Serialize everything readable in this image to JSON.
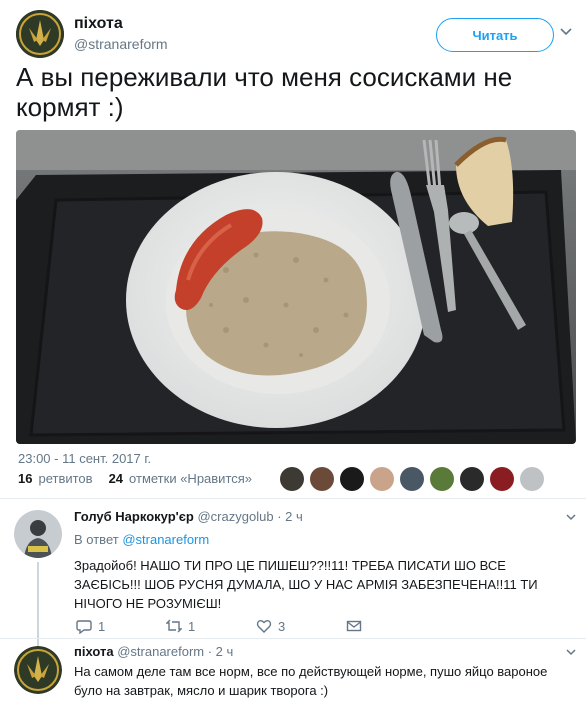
{
  "tweet": {
    "author_name": "піхота",
    "author_handle": "@stranareform",
    "follow_label": "Читать",
    "text": "А вы переживали что меня сосисками не кормят :)",
    "timestamp": "23:00 - 11 сент. 2017 г.",
    "retweets_count": "16",
    "retweets_label": "ретвитов",
    "likes_count": "24",
    "likes_label": "отметки «Нравится»"
  },
  "replies": [
    {
      "author_name": "Голуб Наркокур'єр",
      "author_handle": "@crazygolub",
      "time": "· 2 ч",
      "in_reply_prefix": "В ответ",
      "in_reply_handle": "@stranareform",
      "text": "Зрадойоб! НАШО ТИ ПРО ЦЕ ПИШЕШ??!!11! ТРЕБА ПИСАТИ ШО ВСЕ ЗАЄБІСЬ!!! ШОБ РУСНЯ ДУМАЛА, ШО У НАС АРМІЯ ЗАБЕЗПЕЧЕНА!!11 ТИ НІЧОГО НЕ РОЗУМІЄШ!",
      "reply_count": "1",
      "retweet_count": "1",
      "like_count": "3"
    },
    {
      "author_name": "піхота",
      "author_handle": "@stranareform",
      "time": "· 2 ч",
      "text": "На самом деле там все норм, все по действующей норме, пушо яйцо вароное було на завтрак, мясло и шарик творога :)"
    }
  ],
  "colors": {
    "accent": "#1da1f2",
    "link": "#1b95e0",
    "muted": "#657786",
    "like_heart": "#e0245e"
  }
}
